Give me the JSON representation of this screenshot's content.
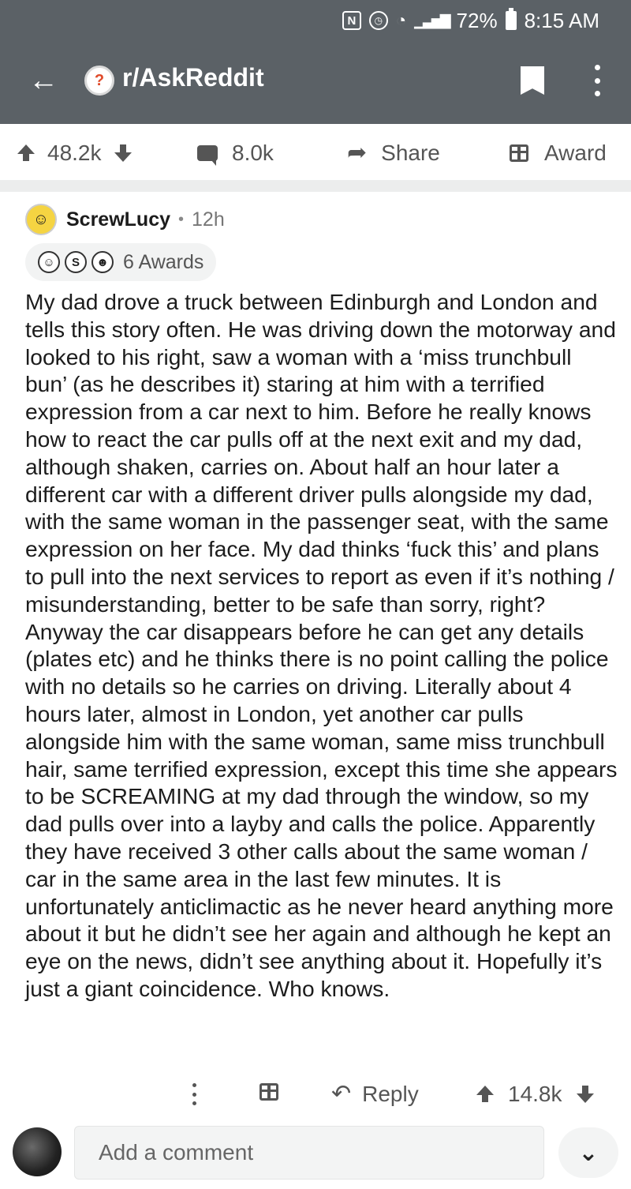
{
  "status_bar": {
    "battery": "72%",
    "time": "8:15 AM"
  },
  "header": {
    "subreddit": "r/AskReddit"
  },
  "post_actions": {
    "votes": "48.2k",
    "comments": "8.0k",
    "share_label": "Share",
    "award_label": "Award"
  },
  "comment": {
    "username": "ScrewLucy",
    "separator": "•",
    "age": "12h",
    "awards_label": "6 Awards",
    "body": "My dad drove a truck between Edinburgh and London and tells this story often. He was driving down the motorway and looked to his right, saw a woman with a ‘miss trunchbull bun’ (as he describes it) staring at him with a terrified expression from a car next to him. Before he really knows how to react the car pulls off at the next exit and my dad, although shaken, carries on. About half an hour later a different car with a different driver pulls alongside my dad, with the same woman in the passenger seat, with the same expression on her face. My dad thinks ‘fuck this’ and plans to pull into the next services to report as even if it’s nothing / misunderstanding, better to be safe than sorry, right? Anyway the car disappears before he can get any details (plates etc) and he thinks there is no point calling the police with no details so he carries on driving. Literally about 4 hours later, almost in London,  yet another car pulls alongside him with the same woman, same miss trunchbull hair, same terrified expression, except this time she appears to be SCREAMING at my dad through the window, so my dad pulls over into a layby and calls the police. Apparently they have received 3 other calls about the same woman / car in the same area in the last few minutes. It is unfortunately anticlimactic as he never heard anything more about it but he didn’t see her again and although he kept an eye on the news, didn’t see anything about it. Hopefully it’s just a giant coincidence. Who knows.",
    "reply_label": "Reply",
    "votes": "14.8k"
  },
  "composer": {
    "placeholder": "Add a comment"
  },
  "icons": {
    "back": "arrow-left-icon",
    "bookmark": "bookmark-icon",
    "more": "kebab-icon",
    "upvote": "arrow-up-icon",
    "downvote": "arrow-down-icon",
    "comment": "comment-icon",
    "share": "share-icon",
    "award": "gift-icon",
    "reply": "reply-icon",
    "expand": "chevron-double-down-icon"
  }
}
